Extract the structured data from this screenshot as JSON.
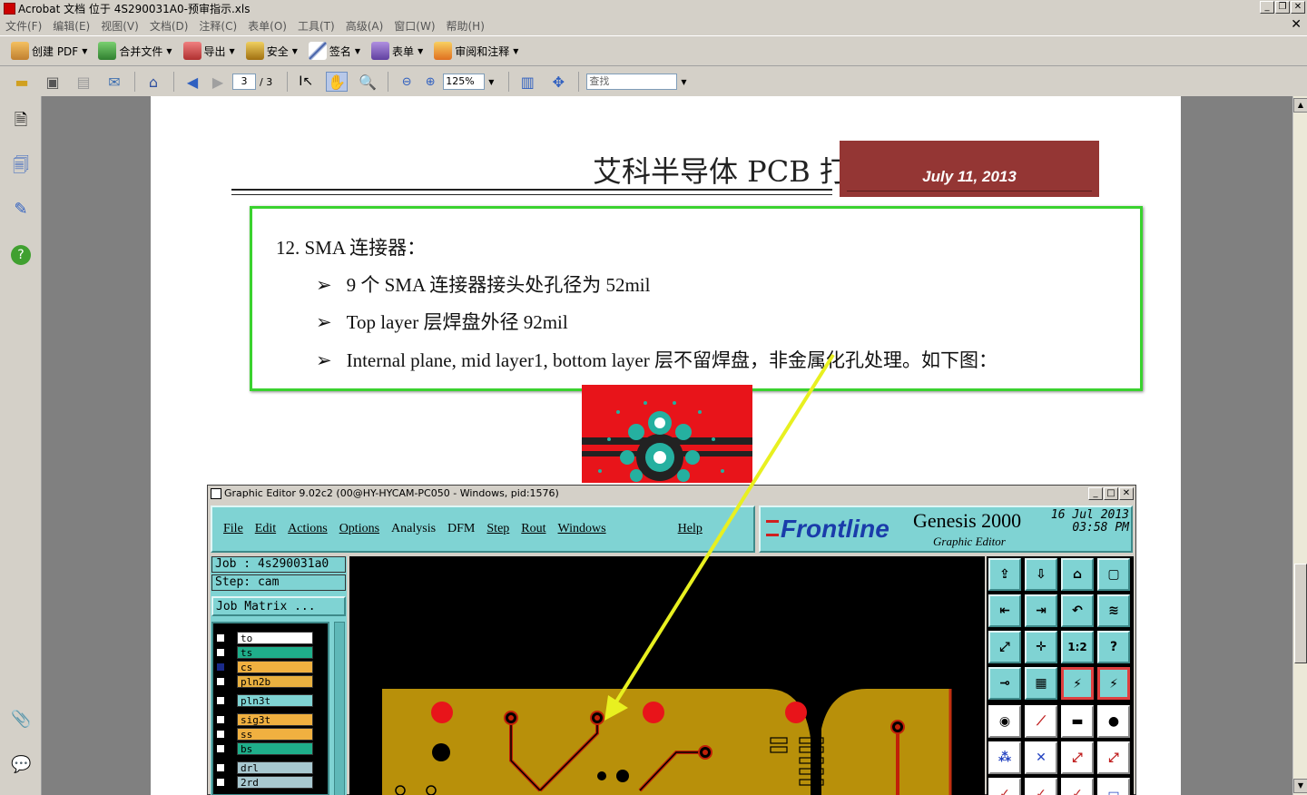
{
  "window": {
    "title": "Acrobat 文档 位于 4S290031A0-预审指示.xls",
    "min": "_",
    "restore": "❐",
    "close": "✕"
  },
  "menubar": {
    "items": [
      "文件(F)",
      "编辑(E)",
      "视图(V)",
      "文档(D)",
      "注释(C)",
      "表单(O)",
      "工具(T)",
      "高级(A)",
      "窗口(W)",
      "帮助(H)"
    ],
    "doc_close": "✕"
  },
  "toolbar1": {
    "items": [
      {
        "label": "创建 PDF"
      },
      {
        "label": "合并文件"
      },
      {
        "label": "导出"
      },
      {
        "label": "安全"
      },
      {
        "label": "签名"
      },
      {
        "label": "表单"
      },
      {
        "label": "审阅和注释"
      }
    ]
  },
  "toolbar2": {
    "page_current": "3",
    "page_total": "/ 3",
    "zoom": "125%",
    "find_placeholder": "查找"
  },
  "page": {
    "header_title": "艾科半导体 PCB 打板要求",
    "header_date": "July 11, 2013",
    "section_heading": "12. SMA 连接器：",
    "bullets": [
      "9 个 SMA 连接器接头处孔径为 52mil",
      "Top layer 层焊盘外径 92mil",
      "Internal plane, mid layer1, bottom layer 层不留焊盘，非金属化孔处理。如下图："
    ],
    "bullet_symbol": "➢"
  },
  "genesis": {
    "title": "Graphic Editor 9.02c2 (00@HY-HYCAM-PC050 - Windows, pid:1576)",
    "menu": [
      "File",
      "Edit",
      "Actions",
      "Options",
      "Analysis",
      "DFM",
      "Step",
      "Rout",
      "Windows",
      "Help"
    ],
    "brand": "Frontline",
    "product": "Genesis 2000",
    "subtitle": "Graphic Editor",
    "date_line1": "16 Jul 2013",
    "date_line2": "03:58 PM",
    "job": "Job : 4s290031a0",
    "step": "Step: cam",
    "job_matrix": "Job Matrix ...",
    "layers": [
      {
        "name": "to",
        "color": "#ffffff"
      },
      {
        "name": "ts",
        "color": "#1fae8a"
      },
      {
        "name": "cs",
        "color": "#f0b040"
      },
      {
        "name": "pln2b",
        "color": "#e8b040"
      },
      {
        "name": "pln3t",
        "color": "#7fd3d3"
      },
      {
        "name": "sig3t",
        "color": "#f0b040"
      },
      {
        "name": "ss",
        "color": "#f0b040"
      },
      {
        "name": "bs",
        "color": "#1fae8a"
      },
      {
        "name": "drl",
        "color": "#a8c8d0"
      },
      {
        "name": "2rd",
        "color": "#a8c8d0"
      }
    ]
  },
  "colors": {
    "accent_green": "#3ad22f",
    "date_box": "#943634",
    "arrow": "#e8f020",
    "genesis_teal": "#7fd3d3",
    "pcb_copper": "#b8900a"
  }
}
